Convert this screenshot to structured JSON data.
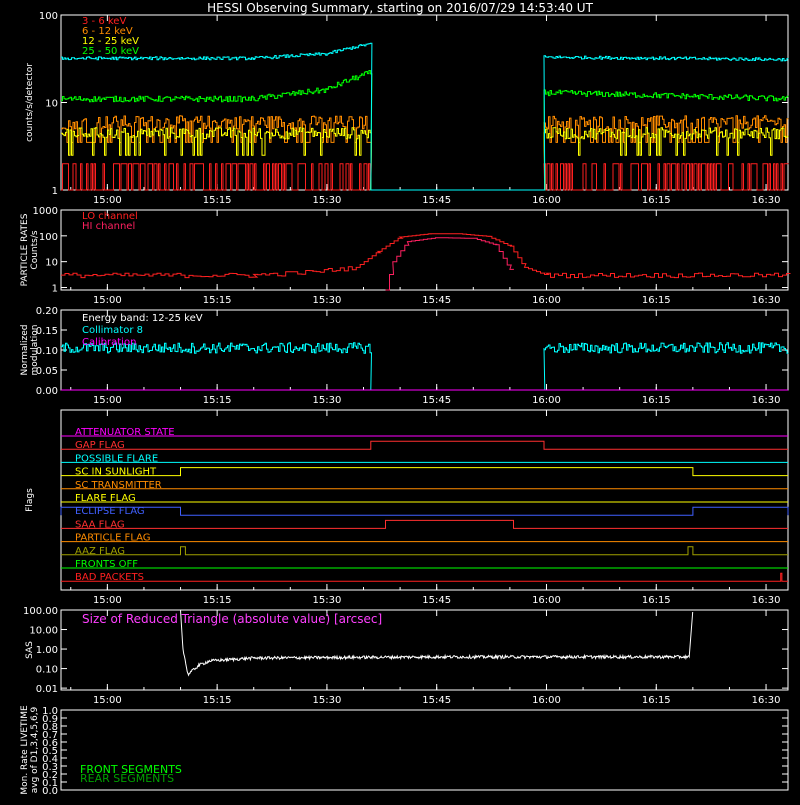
{
  "title": "HESSI Observing Summary, starting on 2016/07/29 14:53:40 UT",
  "chart_data": [
    {
      "id": "count_rates",
      "type": "line",
      "ylabel": "counts/s/detector",
      "yscale": "log",
      "ylim": [
        1,
        100
      ],
      "ytick_labels": [
        "1",
        "10",
        "100"
      ],
      "xtick_labels": [
        "15:00",
        "15:15",
        "15:30",
        "15:45",
        "16:00",
        "16:15",
        "16:30"
      ],
      "series": [
        {
          "name": "3 - 6 keV",
          "color": "#ff2020",
          "segments": [
            [
              "14:53:40",
              2.0
            ],
            [
              "15:36:00",
              2.0
            ],
            [
              "15:36:00",
              1.0
            ],
            [
              "15:59:40",
              1.0
            ],
            [
              "15:59:40",
              2.0
            ],
            [
              "16:33:00",
              2.0
            ]
          ]
        },
        {
          "name": "6 - 12 keV",
          "color": "#ff8c00",
          "segments": [
            [
              "14:53:40",
              6.0
            ],
            [
              "15:36:00",
              6.0
            ],
            [
              "15:36:00",
              1.0
            ],
            [
              "15:59:40",
              1.0
            ],
            [
              "15:59:40",
              6.0
            ],
            [
              "16:33:00",
              6.0
            ]
          ]
        },
        {
          "name": "12 - 25 keV",
          "color": "#ffff00",
          "segments": [
            [
              "14:53:40",
              4.5
            ],
            [
              "15:36:00",
              4.5
            ],
            [
              "15:36:00",
              1.0
            ],
            [
              "15:59:40",
              1.0
            ],
            [
              "15:59:40",
              4.5
            ],
            [
              "16:33:00",
              4.5
            ]
          ]
        },
        {
          "name": "25 - 50 keV",
          "color": "#00ff00",
          "segments": [
            [
              "14:53:40",
              11
            ],
            [
              "15:20:00",
              11
            ],
            [
              "15:30:00",
              14
            ],
            [
              "15:36:00",
              22
            ],
            [
              "15:36:00",
              1.0
            ],
            [
              "15:59:40",
              1.0
            ],
            [
              "15:59:40",
              13
            ],
            [
              "16:33:00",
              11
            ]
          ]
        },
        {
          "name": "",
          "color": "#00ffff",
          "segments": [
            [
              "14:53:40",
              32
            ],
            [
              "15:20:00",
              32
            ],
            [
              "15:30:00",
              36
            ],
            [
              "15:36:00",
              47
            ],
            [
              "15:36:00",
              1.0
            ],
            [
              "15:59:40",
              1.0
            ],
            [
              "15:59:40",
              33
            ],
            [
              "16:33:00",
              31
            ]
          ]
        }
      ]
    },
    {
      "id": "particle_rates",
      "type": "line",
      "ylabel": "PARTICLE RATES Counts/s",
      "yscale": "log",
      "ylim": [
        0.8,
        1000
      ],
      "ytick_labels": [
        "1",
        "10",
        "100",
        "1000"
      ],
      "xtick_labels": [
        "15:00",
        "15:15",
        "15:30",
        "15:45",
        "16:00",
        "16:15",
        "16:30"
      ],
      "series": [
        {
          "name": "LO channel",
          "color": "#ff2020",
          "points": [
            [
              "14:53:40",
              3
            ],
            [
              "15:20:00",
              3
            ],
            [
              "15:28:00",
              4
            ],
            [
              "15:34:00",
              6
            ],
            [
              "15:37:00",
              25
            ],
            [
              "15:40:00",
              90
            ],
            [
              "15:44:00",
              120
            ],
            [
              "15:48:00",
              120
            ],
            [
              "15:52:00",
              95
            ],
            [
              "15:55:00",
              40
            ],
            [
              "15:57:00",
              6
            ],
            [
              "16:00:00",
              3
            ],
            [
              "16:33:00",
              3
            ]
          ]
        },
        {
          "name": "HI channel",
          "color": "#ff2060",
          "points": [
            [
              "15:38:00",
              0.8
            ],
            [
              "15:39:00",
              10
            ],
            [
              "15:41:00",
              60
            ],
            [
              "15:45:00",
              85
            ],
            [
              "15:50:00",
              80
            ],
            [
              "15:53:00",
              45
            ],
            [
              "15:55:00",
              5
            ],
            [
              "15:55:30",
              0.8
            ]
          ]
        }
      ]
    },
    {
      "id": "modulation",
      "type": "line",
      "ylabel": "Normalized modulation",
      "ylim": [
        0.0,
        0.2
      ],
      "ytick_labels": [
        "0.00",
        "0.05",
        "0.10",
        "0.15",
        "0.20"
      ],
      "xtick_labels": [
        "15:00",
        "15:15",
        "15:30",
        "15:45",
        "16:00",
        "16:15",
        "16:30"
      ],
      "annotation": "Energy band: 12-25 keV",
      "series": [
        {
          "name": "Collimator 8",
          "color": "#00ffff",
          "segments": [
            [
              "14:53:40",
              0.105
            ],
            [
              "15:36:00",
              0.105
            ],
            [
              "15:36:00",
              0.0
            ],
            [
              "15:59:40",
              0.0
            ],
            [
              "15:59:40",
              0.105
            ],
            [
              "16:33:00",
              0.105
            ]
          ]
        },
        {
          "name": "Calibration",
          "color": "#ff00ff",
          "points": [
            [
              "14:53:40",
              0.0
            ],
            [
              "16:33:00",
              0.0
            ]
          ]
        }
      ]
    },
    {
      "id": "flags",
      "type": "line",
      "ylabel": "Flags",
      "xtick_labels": [
        "15:00",
        "15:15",
        "15:30",
        "15:45",
        "16:00",
        "16:15",
        "16:30"
      ],
      "flags": [
        {
          "name": "ATTENUATOR STATE",
          "color": "#ff00ff",
          "on": []
        },
        {
          "name": "GAP FLAG",
          "color": "#ff3030",
          "on": [
            [
              "15:36:00",
              "15:59:40"
            ]
          ]
        },
        {
          "name": "POSSIBLE FLARE",
          "color": "#00ffff",
          "on": []
        },
        {
          "name": "SC IN SUNLIGHT",
          "color": "#ffff00",
          "on": [
            [
              "15:10:00",
              "16:20:00"
            ]
          ]
        },
        {
          "name": "SC TRANSMITTER",
          "color": "#ff8c00",
          "on": []
        },
        {
          "name": "FLARE FLAG",
          "color": "#ffff00",
          "on": []
        },
        {
          "name": "ECLIPSE FLAG",
          "color": "#4060ff",
          "on": [
            [
              "14:53:40",
              "15:10:00"
            ],
            [
              "16:20:00",
              "16:33:00"
            ]
          ]
        },
        {
          "name": "SAA FLAG",
          "color": "#ff3030",
          "on": [
            [
              "15:38:00",
              "15:55:30"
            ]
          ]
        },
        {
          "name": "PARTICLE FLAG",
          "color": "#ff8c00",
          "on": []
        },
        {
          "name": "AAZ FLAG",
          "color": "#a0a000",
          "on": [
            [
              "15:10:00",
              "15:10:40"
            ],
            [
              "16:19:20",
              "16:20:00"
            ]
          ]
        },
        {
          "name": "FRONTS OFF",
          "color": "#00ff00",
          "on": []
        },
        {
          "name": "BAD PACKETS",
          "color": "#ff2020",
          "on": [
            [
              "16:32:00",
              "16:32:10"
            ]
          ]
        }
      ]
    },
    {
      "id": "sas",
      "type": "line",
      "ylabel": "SAS",
      "yscale": "log",
      "ylim": [
        0.008,
        100
      ],
      "ytick_labels": [
        "0.01",
        "0.10",
        "1.00",
        "10.00",
        "100.00"
      ],
      "xtick_labels": [
        "15:00",
        "15:15",
        "15:30",
        "15:45",
        "16:00",
        "16:15",
        "16:30"
      ],
      "annotation": "Size of Reduced Triangle (absolute value) [arcsec]",
      "series": [
        {
          "name": "",
          "color": "#ffffff",
          "points": [
            [
              "15:10:00",
              100
            ],
            [
              "15:10:20",
              1.0
            ],
            [
              "15:11:00",
              0.05
            ],
            [
              "15:12:30",
              0.15
            ],
            [
              "15:14:00",
              0.25
            ],
            [
              "15:20:00",
              0.35
            ],
            [
              "15:45:00",
              0.4
            ],
            [
              "16:19:30",
              0.4
            ],
            [
              "16:20:00",
              100
            ]
          ]
        }
      ]
    },
    {
      "id": "livetime",
      "type": "line",
      "ylabel": "Mon. Rate LIVETIME avg of D1,3,4,5,6,9",
      "ylim": [
        0.0,
        1.0
      ],
      "ytick_labels": [
        "0.0",
        "0.1",
        "0.2",
        "0.3",
        "0.4",
        "0.5",
        "0.6",
        "0.7",
        "0.8",
        "0.9",
        "1.0"
      ],
      "series": [
        {
          "name": "FRONT SEGMENTS",
          "color": "#00ff00",
          "points": []
        },
        {
          "name": "REAR SEGMENTS",
          "color": "#00a000",
          "points": []
        }
      ]
    }
  ]
}
